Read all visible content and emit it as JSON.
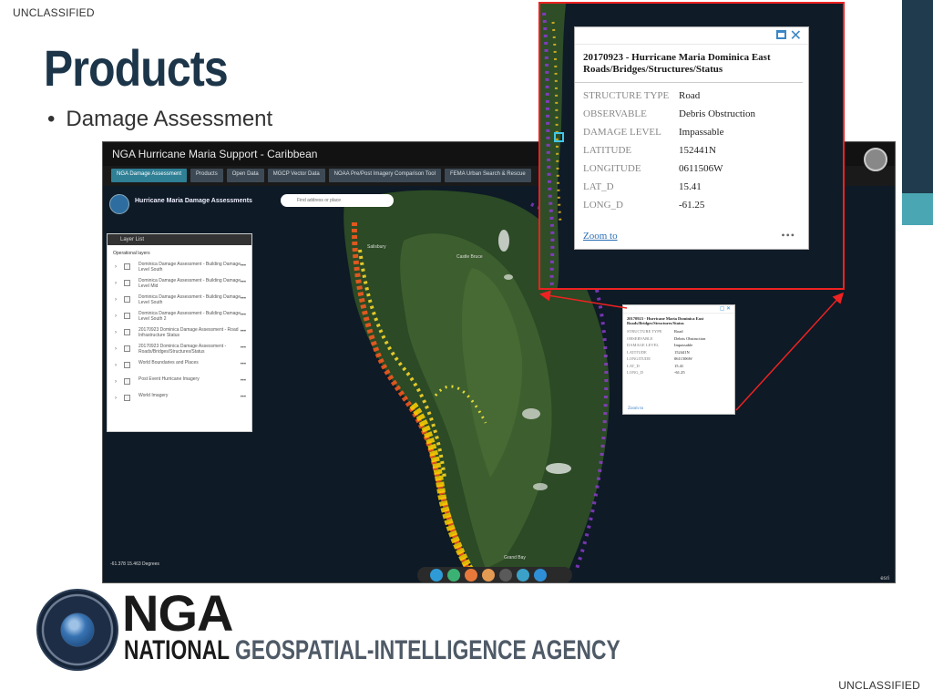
{
  "classification": {
    "top": "UNCLASSIFIED",
    "bottom": "UNCLASSIFIED"
  },
  "slide": {
    "title": "Products",
    "bullet": "Damage Assessment"
  },
  "app": {
    "title": "NGA Hurricane Maria Support - Caribbean",
    "tabs": [
      {
        "label": "NGA Damage Assessment",
        "active": true
      },
      {
        "label": "Products"
      },
      {
        "label": "Open Data"
      },
      {
        "label": "MGCP Vector Data"
      },
      {
        "label": "NOAA Pre/Post Imagery Comparison Tool"
      },
      {
        "label": "FEMA Urban Search & Rescue"
      }
    ],
    "map_title": "Hurricane Maria Damage Assessments",
    "search_placeholder": "Find address or place",
    "layer_list": {
      "title": "Layer List",
      "section": "Operational layers",
      "items": [
        {
          "label": "Dominica Damage Assessment - Building Damage Level South"
        },
        {
          "label": "Dominica Damage Assessment - Building Damage Level Mid"
        },
        {
          "label": "Dominica Damage Assessment - Building Damage Level South"
        },
        {
          "label": "Dominica Damage Assessment - Building Damage Level South 2"
        },
        {
          "label": "20170923 Dominica Damage Assessment - Road Infrastructure Status"
        },
        {
          "label": "20170923 Dominica Damage Assessment - Roads/Bridges/Structures/Status"
        },
        {
          "label": "World Boundaries and Places"
        },
        {
          "label": "Post Event Hurricane Imagery"
        },
        {
          "label": "World Imagery"
        }
      ]
    },
    "scale_text": "-61.378 15.463 Degrees",
    "attribution": "esri"
  },
  "popup": {
    "title": "20170923 - Hurricane Maria Dominica East Roads/Bridges/Structures/Status",
    "fields": [
      {
        "key": "STRUCTURE TYPE",
        "value": "Road"
      },
      {
        "key": "OBSERVABLE",
        "value": "Debris Obstruction"
      },
      {
        "key": "DAMAGE LEVEL",
        "value": "Impassable"
      },
      {
        "key": "LATITUDE",
        "value": "152441N"
      },
      {
        "key": "LONGITUDE",
        "value": "0611506W"
      },
      {
        "key": "LAT_D",
        "value": "15.41"
      },
      {
        "key": "LONG_D",
        "value": "-61.25"
      }
    ],
    "zoom_link": "Zoom to",
    "more": "•••"
  },
  "logo": {
    "acronym": "NGA",
    "full_part1": "NATIONAL",
    "full_part2": "GEOSPATIAL-INTELLIGENCE AGENCY"
  },
  "colors": {
    "title": "#1c3549",
    "accent_dark": "#1f3b4d",
    "accent_teal": "#4aa6b3",
    "highlight_border": "#e22222"
  }
}
